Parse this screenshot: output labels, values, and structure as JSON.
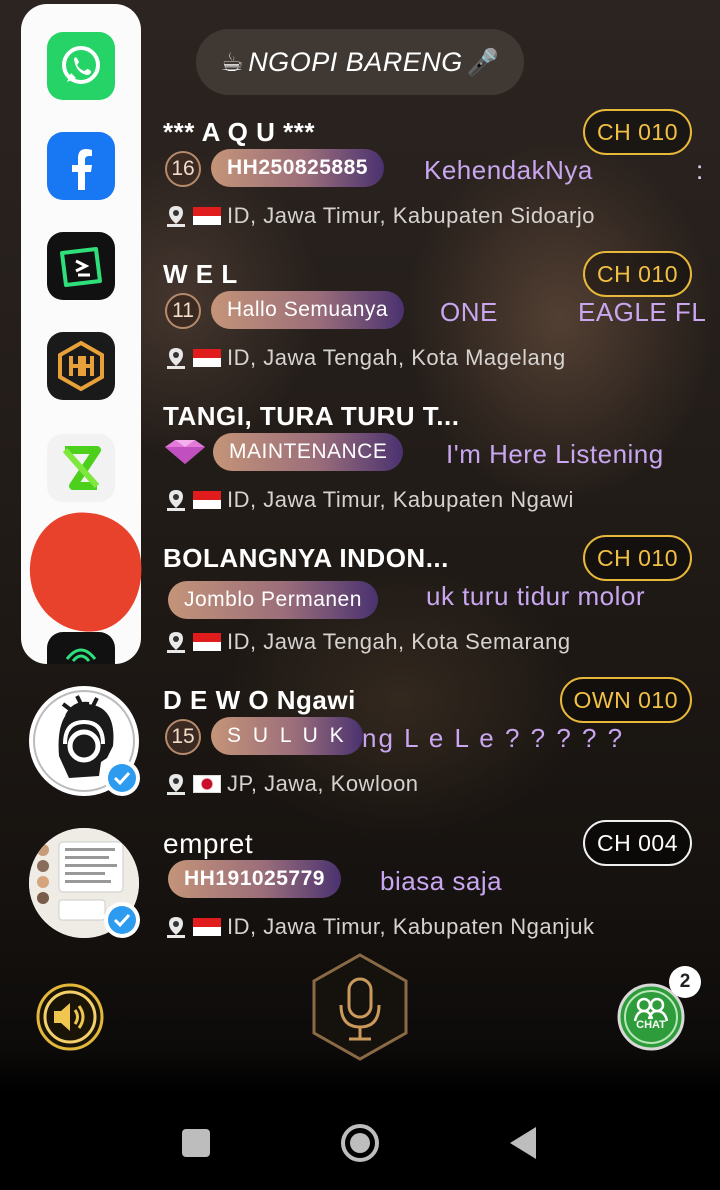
{
  "header": {
    "title": "NGOPI BARENG",
    "left_glyph": "☕",
    "right_glyph": "🎤"
  },
  "app_panel": {
    "apps": [
      {
        "name": "WhatsApp",
        "icon": "whatsapp-icon",
        "color": "#25d366"
      },
      {
        "name": "Facebook",
        "icon": "facebook-icon",
        "color": "#1877f2"
      },
      {
        "name": "Player app",
        "icon": "play-app-icon",
        "color": "#111111"
      },
      {
        "name": "HH app",
        "icon": "hh-app-icon",
        "color": "#1a1a1a"
      },
      {
        "name": "X app",
        "icon": "x-app-icon",
        "color": "#f2f2f2"
      },
      {
        "name": "Redacted app",
        "icon": "redacted-app-icon",
        "color": "#e8412c"
      },
      {
        "name": "Partial app",
        "icon": "partial-app-icon",
        "color": "#111111"
      }
    ]
  },
  "users": [
    {
      "name": "*** A Q U ***",
      "channel": "CH 010",
      "level": "16",
      "tag": "HH250825885",
      "message": "KehendakNya",
      "extra": ":",
      "location": "ID, Jawa Timur, Kabupaten Sidoarjo"
    },
    {
      "name": "W E L",
      "channel": "CH 010",
      "level": "11",
      "tag": "Hallo Semuanya",
      "message": "ONE",
      "extra": "EAGLE FL",
      "location": "ID, Jawa Tengah, Kota Magelang"
    },
    {
      "name": "TANGI, TURA TURU T...",
      "tag": "MAINTENANCE",
      "message": "I'm Here Listening",
      "location": "ID, Jawa Timur, Kabupaten Ngawi"
    },
    {
      "name": "BOLANGNYA INDON...",
      "channel": "CH 010",
      "tag": "Jomblo Permanen",
      "message": "uk turu tidur molor",
      "location": "ID, Jawa Tengah, Kota Semarang"
    },
    {
      "name": "D E W O Ngawi",
      "channel": "OWN 010",
      "level": "15",
      "tag": "S U L U K",
      "message": "ng L e L e ? ? ? ? ?",
      "location": "JP, Jawa, Kowloon"
    },
    {
      "name": "empret",
      "channel": "CH 004",
      "tag": "HH191025779",
      "message": "biasa saja",
      "location": "ID, Jawa Timur, Kabupaten Nganjuk"
    }
  ],
  "controls": {
    "chat_badge_count": "2",
    "chat_label": "CHAT"
  },
  "colors": {
    "gold": "#e8b83a",
    "message": "#c9a6f0",
    "chat_green": "#2e9c3a"
  }
}
